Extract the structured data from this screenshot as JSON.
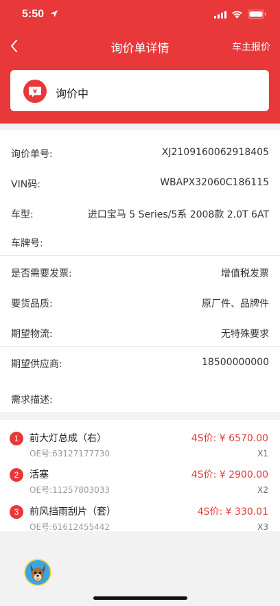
{
  "status_bar": {
    "time": "5:50"
  },
  "nav": {
    "title": "询价单详情",
    "action": "车主报价"
  },
  "status_card": {
    "label": "询价中"
  },
  "info": [
    {
      "label": "询价单号:",
      "value": "XJ2109160062918405"
    },
    {
      "label": "VIN码:",
      "value": "WBAPX32060C186115"
    },
    {
      "label": "车型:",
      "value": "进口宝马 5 Series/5系 2008款 2.0T 6AT"
    },
    {
      "label": "车牌号:",
      "value": ""
    },
    {
      "label": "是否需要发票:",
      "value": "增值税发票"
    },
    {
      "label": "要货品质:",
      "value": "原厂件、品牌件"
    },
    {
      "label": "期望物流:",
      "value": "无特殊要求"
    },
    {
      "label": "期望供应商:",
      "value": "18500000000"
    },
    {
      "label": "需求描述:",
      "value": ""
    }
  ],
  "parts": [
    {
      "index": "1",
      "name": "前大灯总成（右）",
      "oe": "OE号:63127177730",
      "price": "4S价: ¥ 6570.00",
      "qty": "X1"
    },
    {
      "index": "2",
      "name": "活塞",
      "oe": "OE号:11257803033",
      "price": "4S价: ¥ 2900.00",
      "qty": "X2"
    },
    {
      "index": "3",
      "name": "前风挡雨刮片（套）",
      "oe": "OE号:61612455442",
      "price": "4S价: ¥ 330.01",
      "qty": "X3"
    }
  ],
  "colors": {
    "brand_red": "#e8383a",
    "price_red": "#e23b3b"
  }
}
